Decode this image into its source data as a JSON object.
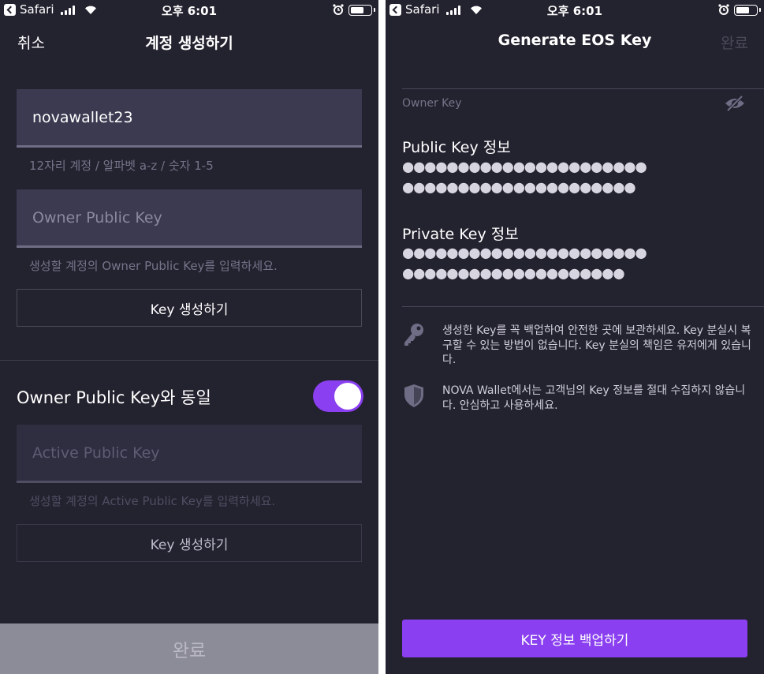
{
  "left": {
    "status": {
      "carrier": "Safari",
      "time": "오후 6:01"
    },
    "nav": {
      "cancel": "취소",
      "title": "계정 생성하기"
    },
    "account_field": {
      "value": "novawallet23",
      "hint": "12자리 계정 / 알파벳 a-z / 숫자 1-5"
    },
    "owner_field": {
      "placeholder": "Owner Public Key",
      "hint": "생성할 계정의 Owner Public Key를 입력하세요."
    },
    "owner_button": "Key 생성하기",
    "toggle": {
      "label": "Owner Public Key와 동일",
      "on": true
    },
    "active_field": {
      "placeholder": "Active Public Key",
      "hint": "생성할 계정의 Active Public Key를 입력하세요."
    },
    "active_button": "Key 생성하기",
    "done": "완료"
  },
  "right": {
    "status": {
      "carrier": "Safari",
      "time": "오후 6:01"
    },
    "nav": {
      "title": "Generate EOS Key",
      "done": "완료"
    },
    "owner_key_label": "Owner Key",
    "public_key": {
      "title": "Public Key 정보",
      "line1": "●●●●●●●●●●●●●●●●●●●●●●",
      "line2": "●●●●●●●●●●●●●●●●●●●●●"
    },
    "private_key": {
      "title": "Private Key 정보",
      "line1": "●●●●●●●●●●●●●●●●●●●●●●",
      "line2": "●●●●●●●●●●●●●●●●●●●●"
    },
    "notice_backup": "생성한 Key를 꼭 백업하여 안전한 곳에 보관하세요. Key 분실시 복구할 수 있는 방법이 없습니다. Key 분실의 책임은 유저에게 있습니다.",
    "notice_privacy": "NOVA Wallet에서는 고객님의 Key 정보를 절대 수집하지 않습니다. 안심하고 사용하세요.",
    "backup_button": "KEY 정보 백업하기"
  },
  "colors": {
    "background": "#23222f",
    "field": "#3b3a51",
    "accent": "#8a3ff0",
    "muted": "#75748a"
  },
  "icons": [
    "back-icon",
    "signal-icon",
    "wifi-icon",
    "alarm-icon",
    "battery-icon",
    "eye-off-icon",
    "key-icon",
    "shield-icon"
  ]
}
